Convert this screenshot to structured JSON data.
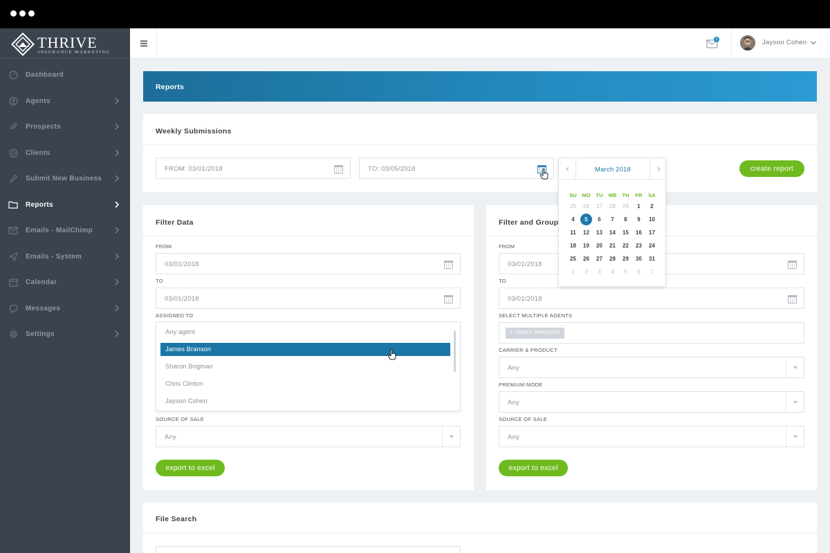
{
  "brand": {
    "name": "THRIVE",
    "tagline": "INSURANCE MARKETING"
  },
  "sidebar": {
    "items": [
      {
        "label": "Dashboard",
        "icon": "dashboard-icon",
        "active": false,
        "has_chevron": false
      },
      {
        "label": "Agents",
        "icon": "agent-icon",
        "active": false,
        "has_chevron": true
      },
      {
        "label": "Prospects",
        "icon": "paperclip-icon",
        "active": false,
        "has_chevron": true
      },
      {
        "label": "Clients",
        "icon": "clients-icon",
        "active": false,
        "has_chevron": true
      },
      {
        "label": "Submit New Business",
        "icon": "pencil-icon",
        "active": false,
        "has_chevron": true
      },
      {
        "label": "Reports",
        "icon": "folder-icon",
        "active": true,
        "has_chevron": true
      },
      {
        "label": "Emails - MailChimp",
        "icon": "envelope-icon",
        "active": false,
        "has_chevron": true
      },
      {
        "label": "Emails - System",
        "icon": "paper-plane-icon",
        "active": false,
        "has_chevron": true
      },
      {
        "label": "Calendar",
        "icon": "calendar-icon",
        "active": false,
        "has_chevron": true
      },
      {
        "label": "Messages",
        "icon": "chat-icon",
        "active": false,
        "has_chevron": true
      },
      {
        "label": "Settings",
        "icon": "gear-icon",
        "active": false,
        "has_chevron": true
      }
    ]
  },
  "topbar": {
    "mail_badge": "2",
    "user_name": "Jayson Cohen"
  },
  "page": {
    "title": "Reports"
  },
  "weekly": {
    "title": "Weekly Submissions",
    "from_value": "FROM: 03/01/2018",
    "to_value": "TO: 03/05/2018",
    "create_label": "create report"
  },
  "calendar": {
    "month_label": "March 2018",
    "weekdays": [
      "SU",
      "MO",
      "TU",
      "WE",
      "TH",
      "FR",
      "SA"
    ],
    "weeks": [
      [
        "25",
        "26",
        "27",
        "28",
        "29",
        "1",
        "2"
      ],
      [
        "4",
        "5",
        "6",
        "7",
        "8",
        "9",
        "10"
      ],
      [
        "11",
        "12",
        "13",
        "14",
        "15",
        "16",
        "17"
      ],
      [
        "18",
        "19",
        "20",
        "21",
        "22",
        "23",
        "24"
      ],
      [
        "25",
        "26",
        "27",
        "28",
        "29",
        "30",
        "31"
      ],
      [
        "1",
        "2",
        "3",
        "4",
        "5",
        "6",
        "7"
      ]
    ],
    "selected": "5"
  },
  "filter": {
    "title": "Filter Data",
    "from_label": "FROM",
    "from_value": "03/01/2018",
    "to_label": "TO",
    "to_value": "03/01/2018",
    "assigned_label": "ASSIGNED TO",
    "assigned_options": [
      "Any agent",
      "James Branson",
      "Sharon Brigman",
      "Chris Clinton",
      "Jayson Cohen"
    ],
    "assigned_selected": "James Branson",
    "source_label": "SOURCE OF SALE",
    "source_value": "Any",
    "export_label": "export to excel"
  },
  "group": {
    "title": "Filter and Group",
    "from_label": "FROM",
    "from_value": "03/01/2018",
    "to_label": "TO",
    "to_value": "03/01/2018",
    "agents_label": "SELECT MULTIPLE AGENTS",
    "agent_chip": "JAMES BRANSON",
    "chip_remove": "×",
    "carrier_label": "CARRIER & PRODUCT",
    "carrier_value": "Any",
    "premium_label": "PREMIUM MODE",
    "premium_value": "Any",
    "source_label": "SOURCE OF SALE",
    "source_value": "Any",
    "export_label": "export to excel"
  },
  "file_search": {
    "title": "File Search"
  },
  "colors": {
    "sidebar_bg": "#3b444e",
    "accent_blue": "#1e78ac",
    "accent_green": "#6fba1f"
  }
}
